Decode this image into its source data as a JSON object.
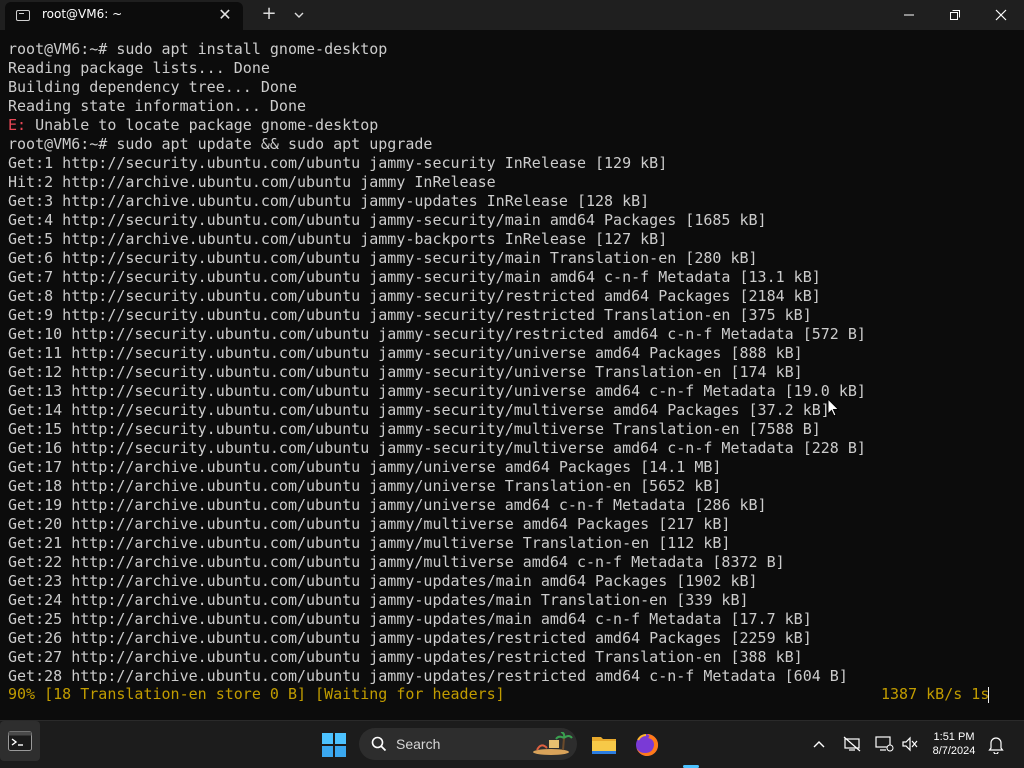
{
  "tab": {
    "title": "root@VM6: ~",
    "close_label": "✕",
    "new_tab_label": "+"
  },
  "terminal": {
    "lines": [
      {
        "text": "root@VM6:~# sudo apt install gnome-desktop"
      },
      {
        "text": "Reading package lists... Done"
      },
      {
        "text": "Building dependency tree... Done"
      },
      {
        "text": "Reading state information... Done"
      },
      {
        "prefix": "E:",
        "text": " Unable to locate package gnome-desktop"
      },
      {
        "text": "root@VM6:~# sudo apt update && sudo apt upgrade"
      },
      {
        "text": "Get:1 http://security.ubuntu.com/ubuntu jammy-security InRelease [129 kB]"
      },
      {
        "text": "Hit:2 http://archive.ubuntu.com/ubuntu jammy InRelease"
      },
      {
        "text": "Get:3 http://archive.ubuntu.com/ubuntu jammy-updates InRelease [128 kB]"
      },
      {
        "text": "Get:4 http://security.ubuntu.com/ubuntu jammy-security/main amd64 Packages [1685 kB]"
      },
      {
        "text": "Get:5 http://archive.ubuntu.com/ubuntu jammy-backports InRelease [127 kB]"
      },
      {
        "text": "Get:6 http://security.ubuntu.com/ubuntu jammy-security/main Translation-en [280 kB]"
      },
      {
        "text": "Get:7 http://security.ubuntu.com/ubuntu jammy-security/main amd64 c-n-f Metadata [13.1 kB]"
      },
      {
        "text": "Get:8 http://security.ubuntu.com/ubuntu jammy-security/restricted amd64 Packages [2184 kB]"
      },
      {
        "text": "Get:9 http://security.ubuntu.com/ubuntu jammy-security/restricted Translation-en [375 kB]"
      },
      {
        "text": "Get:10 http://security.ubuntu.com/ubuntu jammy-security/restricted amd64 c-n-f Metadata [572 B]"
      },
      {
        "text": "Get:11 http://security.ubuntu.com/ubuntu jammy-security/universe amd64 Packages [888 kB]"
      },
      {
        "text": "Get:12 http://security.ubuntu.com/ubuntu jammy-security/universe Translation-en [174 kB]"
      },
      {
        "text": "Get:13 http://security.ubuntu.com/ubuntu jammy-security/universe amd64 c-n-f Metadata [19.0 kB]"
      },
      {
        "text": "Get:14 http://security.ubuntu.com/ubuntu jammy-security/multiverse amd64 Packages [37.2 kB]"
      },
      {
        "text": "Get:15 http://security.ubuntu.com/ubuntu jammy-security/multiverse Translation-en [7588 B]"
      },
      {
        "text": "Get:16 http://security.ubuntu.com/ubuntu jammy-security/multiverse amd64 c-n-f Metadata [228 B]"
      },
      {
        "text": "Get:17 http://archive.ubuntu.com/ubuntu jammy/universe amd64 Packages [14.1 MB]"
      },
      {
        "text": "Get:18 http://archive.ubuntu.com/ubuntu jammy/universe Translation-en [5652 kB]"
      },
      {
        "text": "Get:19 http://archive.ubuntu.com/ubuntu jammy/universe amd64 c-n-f Metadata [286 kB]"
      },
      {
        "text": "Get:20 http://archive.ubuntu.com/ubuntu jammy/multiverse amd64 Packages [217 kB]"
      },
      {
        "text": "Get:21 http://archive.ubuntu.com/ubuntu jammy/multiverse Translation-en [112 kB]"
      },
      {
        "text": "Get:22 http://archive.ubuntu.com/ubuntu jammy/multiverse amd64 c-n-f Metadata [8372 B]"
      },
      {
        "text": "Get:23 http://archive.ubuntu.com/ubuntu jammy-updates/main amd64 Packages [1902 kB]"
      },
      {
        "text": "Get:24 http://archive.ubuntu.com/ubuntu jammy-updates/main Translation-en [339 kB]"
      },
      {
        "text": "Get:25 http://archive.ubuntu.com/ubuntu jammy-updates/main amd64 c-n-f Metadata [17.7 kB]"
      },
      {
        "text": "Get:26 http://archive.ubuntu.com/ubuntu jammy-updates/restricted amd64 Packages [2259 kB]"
      },
      {
        "text": "Get:27 http://archive.ubuntu.com/ubuntu jammy-updates/restricted Translation-en [388 kB]"
      },
      {
        "text": "Get:28 http://archive.ubuntu.com/ubuntu jammy-updates/restricted amd64 c-n-f Metadata [604 B]"
      }
    ],
    "progress_text": "90% [18 Translation-en store 0 B] [Waiting for headers]",
    "rate_text": "1387 kB/s 1s"
  },
  "taskbar": {
    "search_label": "Search",
    "clock_time": "1:51 PM",
    "clock_date": "8/7/2024"
  },
  "colors": {
    "terminal_bg": "#0c0c0c",
    "terminal_fg": "#cccccc",
    "error_red": "#e74856",
    "progress_yellow": "#c19c00",
    "accent_blue": "#4cc2ff"
  },
  "icons": {
    "tab": "terminal-icon",
    "start": "windows-start-icon",
    "search": "search-icon",
    "explorer": "file-explorer-icon",
    "browser": "firefox-icon",
    "terminal_app": "terminal-app-icon",
    "network": "network-disconnected-icon",
    "vpn": "vpn-icon",
    "speaker": "speaker-muted-icon",
    "notifications": "bell-icon"
  }
}
